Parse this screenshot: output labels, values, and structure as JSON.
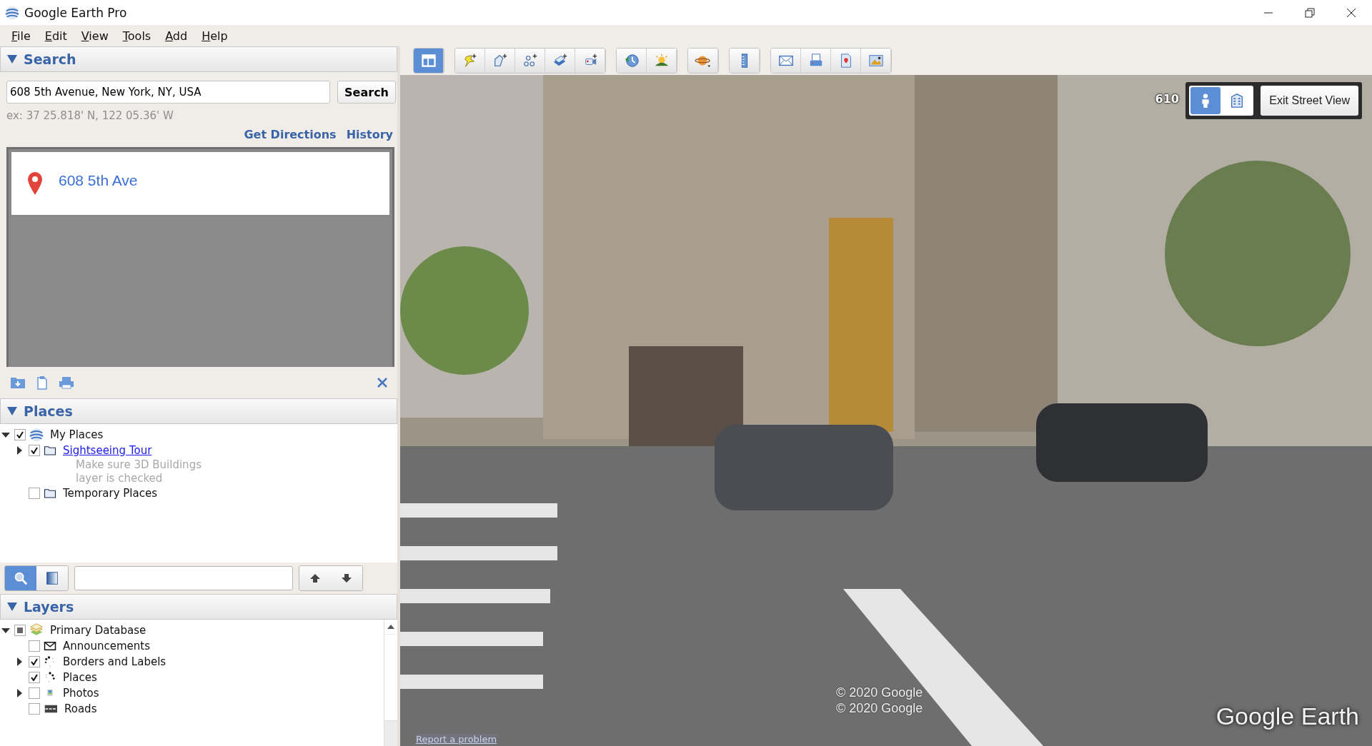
{
  "window": {
    "title": "Google Earth Pro"
  },
  "menu": [
    {
      "label": "File"
    },
    {
      "label": "Edit"
    },
    {
      "label": "View"
    },
    {
      "label": "Tools"
    },
    {
      "label": "Add"
    },
    {
      "label": "Help"
    }
  ],
  "search": {
    "header": "Search",
    "expanded": true,
    "query": "608 5th Avenue, New York, NY, USA",
    "button": "Search",
    "hint": "ex: 37 25.818' N, 122 05.36' W",
    "links": [
      "Get Directions",
      "History"
    ],
    "results": [
      {
        "title": "608 5th Ave"
      }
    ]
  },
  "places": {
    "header": "Places",
    "expanded": true,
    "items": [
      {
        "label": "My Places",
        "kind": "globe",
        "checked": true,
        "expanded": true,
        "children": [
          {
            "label": "Sightseeing Tour",
            "kind": "folder",
            "checked": true,
            "expanded": false,
            "link": true,
            "description": "Make sure 3D Buildings layer is checked"
          },
          {
            "label": "Temporary Places",
            "kind": "folder",
            "checked": false
          }
        ]
      }
    ],
    "modes": [
      {
        "kind": "search",
        "selected": true
      },
      {
        "kind": "panel",
        "selected": false
      }
    ]
  },
  "layers": {
    "header": "Layers",
    "expanded": true,
    "items": [
      {
        "label": "Primary Database",
        "kind": "layers",
        "checked": false,
        "partial": true,
        "expanded": true,
        "children": [
          {
            "label": "Announcements",
            "kind": "envelope",
            "checked": false
          },
          {
            "label": "Borders and Labels",
            "kind": "dots",
            "checked": true,
            "expanded": false
          },
          {
            "label": "Places",
            "kind": "dots2",
            "checked": true
          },
          {
            "label": "Photos",
            "kind": "photo",
            "checked": false,
            "expanded": false
          },
          {
            "label": "Roads",
            "kind": "road",
            "checked": false
          }
        ]
      }
    ]
  },
  "toolbar": [
    {
      "buttons": [
        {
          "kind": "sidebar",
          "selected": true
        }
      ]
    },
    {
      "buttons": [
        {
          "kind": "placemark",
          "selected": false
        },
        {
          "kind": "polygon",
          "selected": false
        },
        {
          "kind": "path",
          "selected": false
        },
        {
          "kind": "overlay",
          "selected": false
        },
        {
          "kind": "tour",
          "selected": false
        }
      ]
    },
    {
      "buttons": [
        {
          "kind": "history",
          "selected": false
        },
        {
          "kind": "sun",
          "selected": false
        }
      ]
    },
    {
      "buttons": [
        {
          "kind": "planet",
          "selected": false
        }
      ]
    },
    {
      "buttons": [
        {
          "kind": "ruler",
          "selected": false
        }
      ]
    },
    {
      "buttons": [
        {
          "kind": "email",
          "selected": false
        },
        {
          "kind": "print",
          "selected": false
        },
        {
          "kind": "map",
          "selected": false
        },
        {
          "kind": "image",
          "selected": false
        }
      ]
    }
  ],
  "street_view": {
    "address_label": "610",
    "modes": [
      {
        "kind": "person",
        "selected": true
      },
      {
        "kind": "building",
        "selected": false
      }
    ],
    "exit_button": "Exit Street View",
    "copyrights": [
      "© 2020 Google",
      "© 2020 Google"
    ],
    "logo": "Google Earth",
    "report_link": "Report a problem"
  }
}
